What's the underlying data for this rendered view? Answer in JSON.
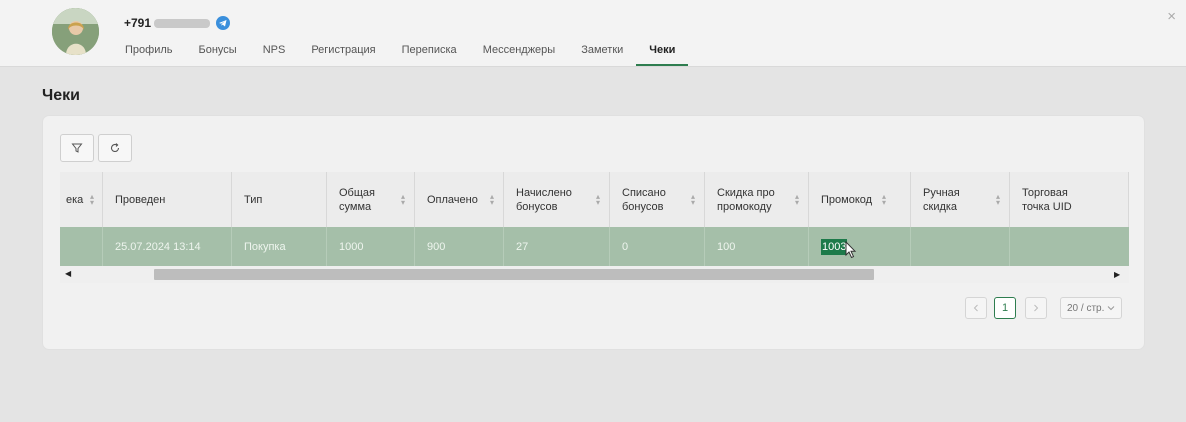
{
  "header": {
    "phone_prefix": "+791",
    "tabs": [
      {
        "label": "Профиль"
      },
      {
        "label": "Бонусы"
      },
      {
        "label": "NPS"
      },
      {
        "label": "Регистрация"
      },
      {
        "label": "Переписка"
      },
      {
        "label": "Мессенджеры"
      },
      {
        "label": "Заметки"
      },
      {
        "label": "Чеки"
      }
    ],
    "active_tab": "Чеки",
    "close_glyph": "×"
  },
  "page": {
    "title": "Чеки"
  },
  "table": {
    "columns": [
      {
        "label": "ека"
      },
      {
        "label": "Проведен"
      },
      {
        "label": "Тип"
      },
      {
        "label": "Общая сумма"
      },
      {
        "label": "Оплачено"
      },
      {
        "label": "Начислено бонусов"
      },
      {
        "label": "Списано бонусов"
      },
      {
        "label": "Скидка про промокоду"
      },
      {
        "label": "Промокод"
      },
      {
        "label": "Ручная скидка"
      },
      {
        "label": "Торговая точка UID"
      }
    ],
    "rows": [
      {
        "cells": [
          "",
          "25.07.2024 13:14",
          "Покупка",
          "1000",
          "900",
          "27",
          "0",
          "100",
          "1003",
          "",
          ""
        ]
      }
    ]
  },
  "pagination": {
    "current_page": "1",
    "page_size": "20 / стр."
  },
  "colors": {
    "accent": "#2e7d4f",
    "row_selected": "#a5bfa9",
    "highlight": "#1d7a4a"
  },
  "icons": [
    "filter-icon",
    "refresh-icon",
    "telegram-icon",
    "close-icon",
    "sort-icon",
    "chevron-left-icon",
    "chevron-right-icon",
    "chevron-down-icon",
    "mouse-cursor-icon"
  ]
}
